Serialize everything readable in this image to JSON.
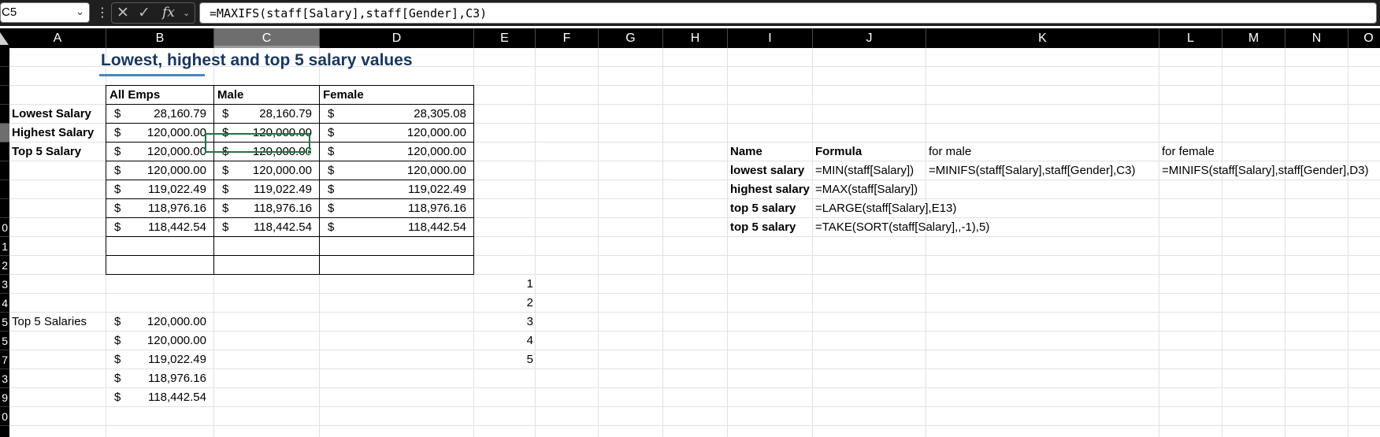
{
  "formula_bar": {
    "name_box": "C5",
    "formula": "=MAXIFS(staff[Salary],staff[Gender],C3)",
    "fx_label": "fx"
  },
  "columns": [
    "A",
    "B",
    "C",
    "D",
    "E",
    "F",
    "G",
    "H",
    "I",
    "J",
    "K",
    "L",
    "M",
    "N",
    "O"
  ],
  "rows": [
    "",
    "",
    "",
    "",
    "",
    "",
    "",
    "",
    "",
    "0",
    "1",
    "2",
    "3",
    "4",
    "5",
    "5",
    "7",
    "3",
    "9",
    "0"
  ],
  "title": "Lowest, highest and top 5 salary values",
  "table": {
    "headers": [
      "All Emps",
      "Male",
      "Female"
    ],
    "row_labels": [
      "Lowest Salary",
      "Highest Salary",
      "Top 5 Salary"
    ],
    "currency": "$",
    "values": [
      [
        "28,160.79",
        "28,160.79",
        "28,305.08"
      ],
      [
        "120,000.00",
        "120,000.00",
        "120,000.00"
      ],
      [
        "120,000.00",
        "120,000.00",
        "120,000.00"
      ],
      [
        "120,000.00",
        "120,000.00",
        "120,000.00"
      ],
      [
        "119,022.49",
        "119,022.49",
        "119,022.49"
      ],
      [
        "118,976.16",
        "118,976.16",
        "118,976.16"
      ],
      [
        "118,442.54",
        "118,442.54",
        "118,442.54"
      ]
    ]
  },
  "top5": {
    "label": "Top 5 Salaries",
    "currency": "$",
    "values": [
      "120,000.00",
      "120,000.00",
      "119,022.49",
      "118,976.16",
      "118,442.54"
    ],
    "ranks": [
      "1",
      "2",
      "3",
      "4",
      "5"
    ]
  },
  "formulas": {
    "headers": [
      "Name",
      "Formula",
      "for male",
      "for female"
    ],
    "rows": [
      {
        "name": "lowest salary",
        "formula": "=MIN(staff[Salary])",
        "male": "=MINIFS(staff[Salary],staff[Gender],C3)",
        "female": "=MINIFS(staff[Salary],staff[Gender],D3)"
      },
      {
        "name": "highest salary",
        "formula": "=MAX(staff[Salary])",
        "male": "",
        "female": ""
      },
      {
        "name": "top 5 salary",
        "formula": "=LARGE(staff[Salary],E13)",
        "male": "",
        "female": ""
      },
      {
        "name": "top 5 salary",
        "formula": "=TAKE(SORT(staff[Salary],,-1),5)",
        "male": "",
        "female": ""
      }
    ]
  },
  "colors": {
    "title": "#17375e",
    "title_underline": "#4a86c0",
    "active_cell": "#217346"
  }
}
